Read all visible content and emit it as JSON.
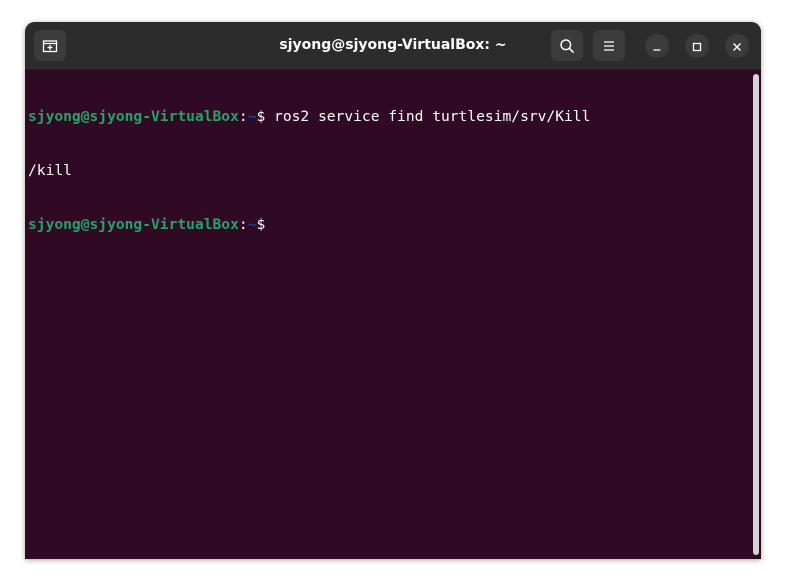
{
  "window": {
    "title": "sjyong@sjyong-VirtualBox: ~"
  },
  "icons": {
    "new_tab": "new-tab-icon",
    "search": "search-icon",
    "menu": "hamburger-menu-icon",
    "minimize": "minimize-icon",
    "maximize": "maximize-icon",
    "close": "close-icon"
  },
  "colors": {
    "terminal_bg": "#300a24",
    "titlebar_bg": "#2c2c2c",
    "prompt_user": "#26a269",
    "prompt_path": "#12488b",
    "text": "#ffffff"
  },
  "terminal": {
    "lines": [
      {
        "user": "sjyong@sjyong-VirtualBox",
        "sep": ":",
        "path": "~",
        "symbol": "$",
        "command": " ros2 service find turtlesim/srv/Kill"
      },
      {
        "output": "/kill"
      },
      {
        "user": "sjyong@sjyong-VirtualBox",
        "sep": ":",
        "path": "~",
        "symbol": "$",
        "command": ""
      }
    ]
  }
}
